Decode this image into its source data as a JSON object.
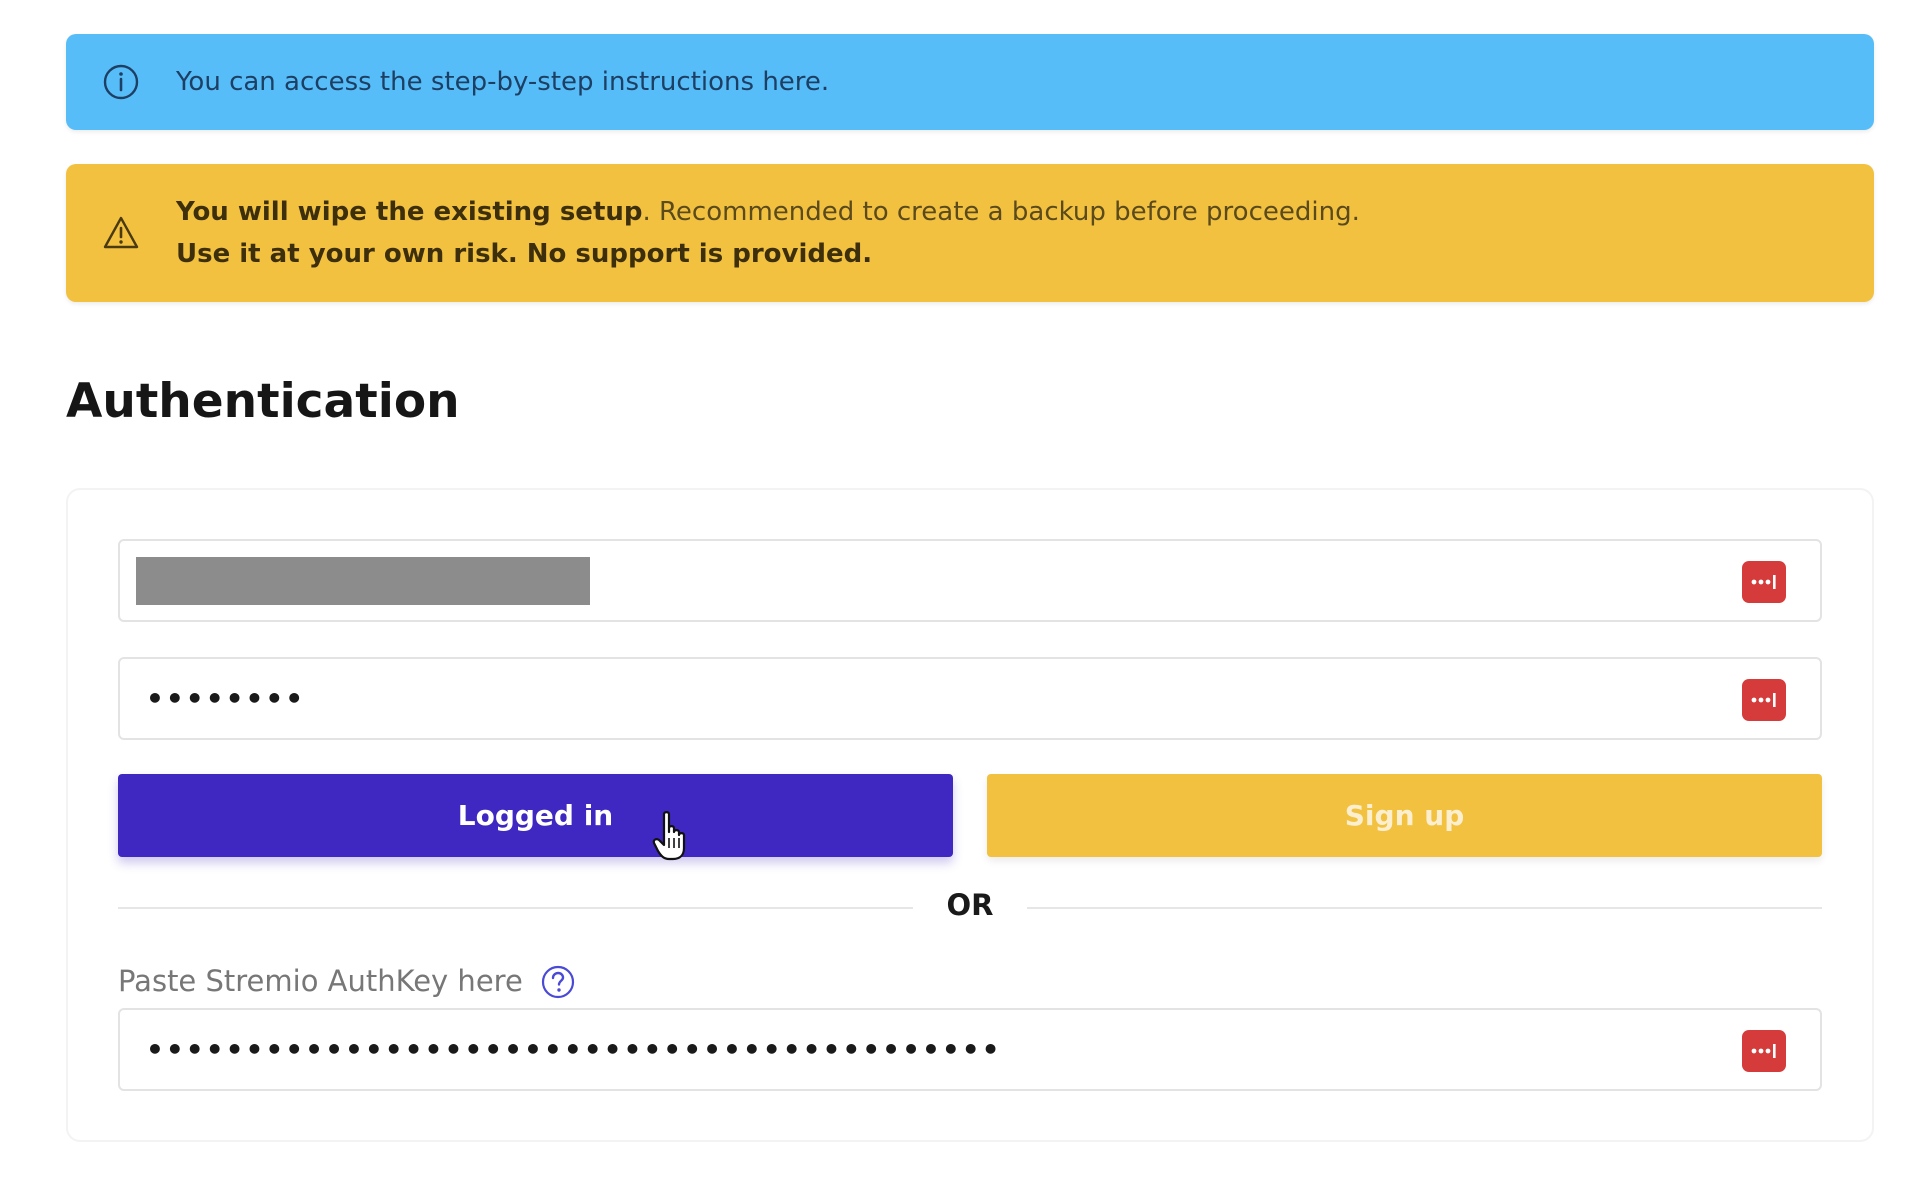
{
  "info_alert": {
    "text": "You can access the step-by-step instructions here.",
    "icon": "info-circle-icon",
    "color": "#57bdf8"
  },
  "warning_alert": {
    "bold_lead": "You will wipe the existing setup",
    "rest": ". Recommended to create a backup before proceeding.",
    "line2": "Use it at your own risk. No support is provided.",
    "icon": "warning-triangle-icon",
    "color": "#f2c140"
  },
  "auth": {
    "title": "Authentication",
    "email_value_redacted": true,
    "password_value": "••••••••",
    "login_button": "Logged in",
    "signup_button": "Sign up",
    "divider": "OR",
    "authkey_label": "Paste Stremio AuthKey here",
    "authkey_value": "•••••••••••••••••••••••••••••••••••••••••••",
    "pw_manager_icon": "password-manager-icon",
    "login_color": "#3f28c2",
    "signup_color": "#f2c140",
    "pw_manager_color": "#d53b3b"
  }
}
